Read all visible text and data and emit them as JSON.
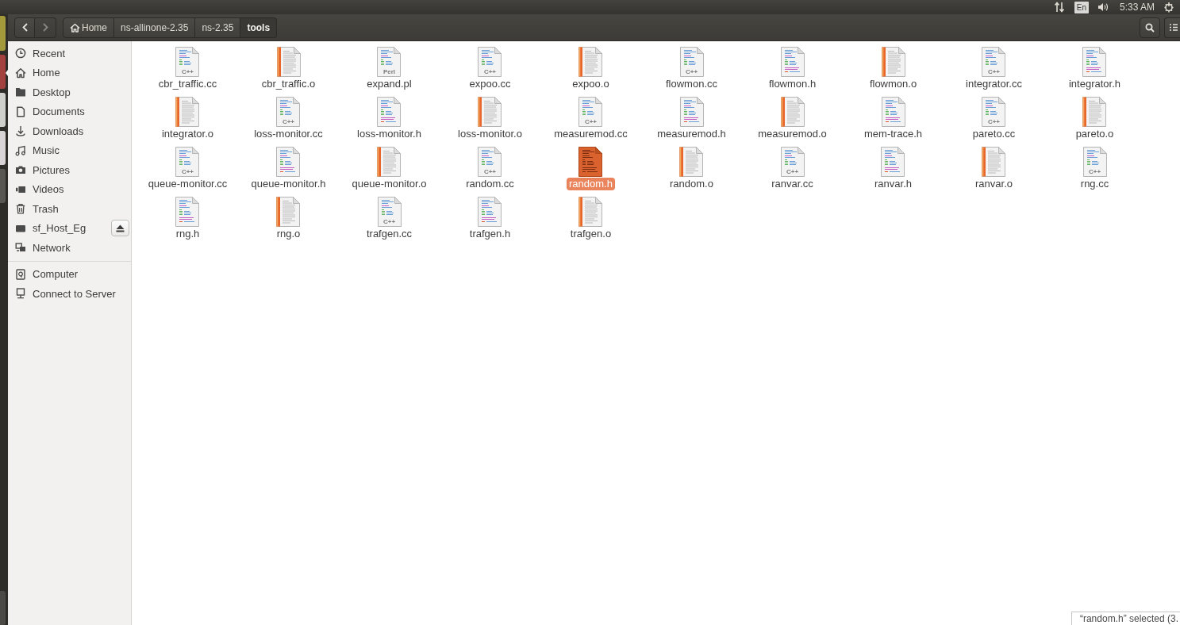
{
  "top_panel": {
    "keyboard_layout": "En",
    "clock": "5:33 AM"
  },
  "toolbar": {
    "back": {
      "disabled": false
    },
    "forward": {
      "disabled": true
    },
    "path": [
      {
        "label": "Home",
        "kind": "home",
        "selected": false
      },
      {
        "label": "ns-allinone-2.35",
        "kind": "folder",
        "selected": false
      },
      {
        "label": "ns-2.35",
        "kind": "folder",
        "selected": false
      },
      {
        "label": "tools",
        "kind": "folder",
        "selected": true
      }
    ]
  },
  "sidebar": {
    "sections": [
      {
        "items": [
          {
            "label": "Recent",
            "kind": "recent",
            "ejectable": false
          },
          {
            "label": "Home",
            "kind": "home",
            "ejectable": false
          },
          {
            "label": "Desktop",
            "kind": "desktop",
            "ejectable": false
          },
          {
            "label": "Documents",
            "kind": "documents",
            "ejectable": false
          },
          {
            "label": "Downloads",
            "kind": "downloads",
            "ejectable": false
          },
          {
            "label": "Music",
            "kind": "music",
            "ejectable": false
          },
          {
            "label": "Pictures",
            "kind": "pictures",
            "ejectable": false
          },
          {
            "label": "Videos",
            "kind": "videos",
            "ejectable": false
          },
          {
            "label": "Trash",
            "kind": "trash",
            "ejectable": false
          },
          {
            "label": "sf_Host_Eg",
            "kind": "drive",
            "ejectable": true
          },
          {
            "label": "Network",
            "kind": "network",
            "ejectable": false
          }
        ]
      },
      {
        "items": [
          {
            "label": "Computer",
            "kind": "computer",
            "ejectable": false
          },
          {
            "label": "Connect to Server",
            "kind": "server",
            "ejectable": false
          }
        ]
      }
    ]
  },
  "files": [
    {
      "name": "cbr_traffic.cc",
      "kind": "source",
      "icon_label": "C++",
      "selected": false
    },
    {
      "name": "cbr_traffic.o",
      "kind": "object",
      "selected": false
    },
    {
      "name": "expand.pl",
      "kind": "source",
      "icon_label": "Perl",
      "selected": false
    },
    {
      "name": "expoo.cc",
      "kind": "source",
      "icon_label": "C++",
      "selected": false
    },
    {
      "name": "expoo.o",
      "kind": "object",
      "selected": false
    },
    {
      "name": "flowmon.cc",
      "kind": "source",
      "icon_label": "C++",
      "selected": false
    },
    {
      "name": "flowmon.h",
      "kind": "header",
      "selected": false
    },
    {
      "name": "flowmon.o",
      "kind": "object",
      "selected": false
    },
    {
      "name": "integrator.cc",
      "kind": "source",
      "icon_label": "C++",
      "selected": false
    },
    {
      "name": "integrator.h",
      "kind": "header",
      "selected": false
    },
    {
      "name": "integrator.o",
      "kind": "object",
      "selected": false
    },
    {
      "name": "loss-monitor.cc",
      "kind": "source",
      "icon_label": "C++",
      "selected": false
    },
    {
      "name": "loss-monitor.h",
      "kind": "header",
      "selected": false
    },
    {
      "name": "loss-monitor.o",
      "kind": "object",
      "selected": false
    },
    {
      "name": "measuremod.cc",
      "kind": "source",
      "icon_label": "C++",
      "selected": false
    },
    {
      "name": "measuremod.h",
      "kind": "header",
      "selected": false
    },
    {
      "name": "measuremod.o",
      "kind": "object",
      "selected": false
    },
    {
      "name": "mem-trace.h",
      "kind": "header",
      "selected": false
    },
    {
      "name": "pareto.cc",
      "kind": "source",
      "icon_label": "C++",
      "selected": false
    },
    {
      "name": "pareto.o",
      "kind": "object",
      "selected": false
    },
    {
      "name": "queue-monitor.cc",
      "kind": "source",
      "icon_label": "C++",
      "selected": false
    },
    {
      "name": "queue-monitor.h",
      "kind": "header",
      "selected": false
    },
    {
      "name": "queue-monitor.o",
      "kind": "object",
      "selected": false
    },
    {
      "name": "random.cc",
      "kind": "source",
      "icon_label": "C++",
      "selected": false
    },
    {
      "name": "random.h",
      "kind": "header",
      "selected": true
    },
    {
      "name": "random.o",
      "kind": "object",
      "selected": false
    },
    {
      "name": "ranvar.cc",
      "kind": "source",
      "icon_label": "C++",
      "selected": false
    },
    {
      "name": "ranvar.h",
      "kind": "header",
      "selected": false
    },
    {
      "name": "ranvar.o",
      "kind": "object",
      "selected": false
    },
    {
      "name": "rng.cc",
      "kind": "source",
      "icon_label": "C++",
      "selected": false
    },
    {
      "name": "rng.h",
      "kind": "header",
      "selected": false
    },
    {
      "name": "rng.o",
      "kind": "object",
      "selected": false
    },
    {
      "name": "trafgen.cc",
      "kind": "source",
      "icon_label": "C++",
      "selected": false
    },
    {
      "name": "trafgen.h",
      "kind": "header",
      "selected": false
    },
    {
      "name": "trafgen.o",
      "kind": "object",
      "selected": false
    }
  ],
  "status_bar": {
    "text": "“random.h” selected (3."
  }
}
